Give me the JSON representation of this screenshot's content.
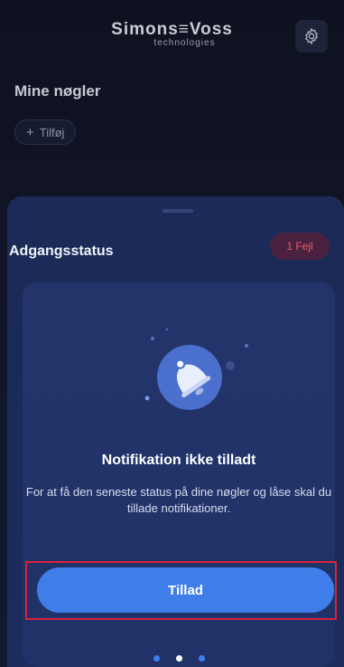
{
  "header": {
    "logo_main": "Simons≡Voss",
    "logo_sub": "technologies",
    "settings_icon": "gear-icon"
  },
  "main": {
    "title": "Mine nøgler",
    "add_button_plus": "+",
    "add_button_label": "Tilføj"
  },
  "sheet": {
    "title": "Adgangsstatus",
    "error_badge": "1 Fejl",
    "card": {
      "illustration_icon": "notification-bell-icon",
      "title": "Notifikation ikke tilladt",
      "description": "For at få den seneste status på dine nøgler og låse skal du tillade notifikationer.",
      "button_label": "Tillad"
    },
    "pagination": {
      "count": 3,
      "active_index": 1
    }
  },
  "colors": {
    "accent": "#3f7ee8",
    "error": "#e85a6a",
    "highlight": "#d7233a"
  }
}
